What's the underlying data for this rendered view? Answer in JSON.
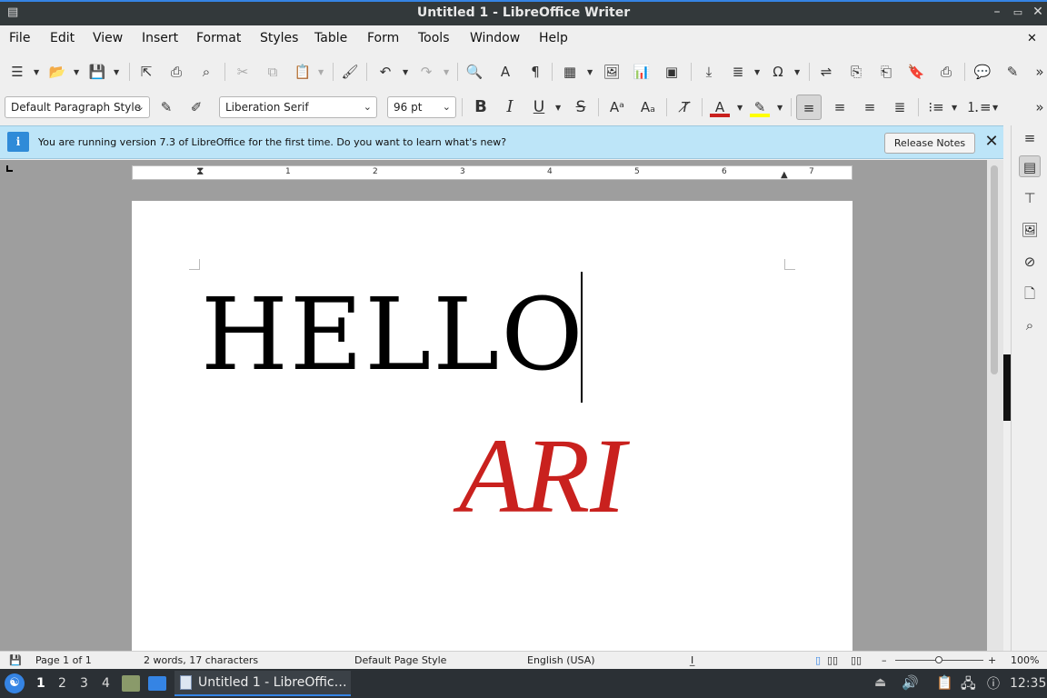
{
  "window": {
    "title": "Untitled 1 - LibreOffice Writer"
  },
  "menu": [
    "File",
    "Edit",
    "View",
    "Insert",
    "Format",
    "Styles",
    "Table",
    "Form",
    "Tools",
    "Window",
    "Help"
  ],
  "format_bar": {
    "paragraph_style": "Default Paragraph Style",
    "font_name": "Liberation Serif",
    "font_size": "96 pt"
  },
  "infobar": {
    "message": "You are running version 7.3 of LibreOffice for the first time. Do you want to learn what's new?",
    "button": "Release Notes"
  },
  "ruler": {
    "numbers": [
      "1",
      "2",
      "3",
      "4",
      "5",
      "6",
      "7"
    ]
  },
  "document": {
    "line1": "HELLO",
    "line2": "ARI"
  },
  "colors": {
    "ari_text": "#c9211e",
    "accent": "#3584e4",
    "infobar": "#bde5f8"
  },
  "status": {
    "page": "Page 1 of 1",
    "words": "2 words, 17 characters",
    "page_style": "Default Page Style",
    "language": "English (USA)",
    "zoom": "100%"
  },
  "taskbar": {
    "workspaces": [
      "1",
      "2",
      "3",
      "4"
    ],
    "active_task": "Untitled 1 - LibreOffic…",
    "clock": "12:35"
  }
}
